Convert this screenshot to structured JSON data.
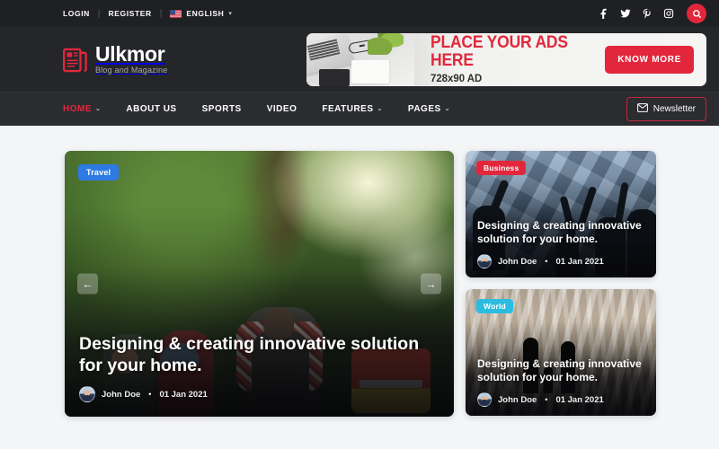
{
  "topbar": {
    "login": "LOGIN",
    "register": "REGISTER",
    "separator": "|",
    "language": "ENGLISH",
    "language_caret": "▾",
    "socials": [
      {
        "name": "facebook-icon",
        "label": "Facebook"
      },
      {
        "name": "twitter-icon",
        "label": "Twitter"
      },
      {
        "name": "pinterest-icon",
        "label": "Pinterest"
      },
      {
        "name": "instagram-icon",
        "label": "Instagram"
      }
    ],
    "search_label": "Search"
  },
  "brand": {
    "name": "Ulkmor",
    "tagline": "Blog and Magazine",
    "accent": "#e2273c"
  },
  "ad": {
    "title": "PLACE YOUR ADS HERE",
    "subtitle": "728x90 AD",
    "cta": "KNOW MORE"
  },
  "nav": {
    "items": [
      {
        "label": "HOME",
        "active": true,
        "caret": "⌄"
      },
      {
        "label": "ABOUT US",
        "active": false,
        "caret": ""
      },
      {
        "label": "SPORTS",
        "active": false,
        "caret": ""
      },
      {
        "label": "VIDEO",
        "active": false,
        "caret": ""
      },
      {
        "label": "FEATURES",
        "active": false,
        "caret": "⌄"
      },
      {
        "label": "PAGES",
        "active": false,
        "caret": "⌄"
      }
    ],
    "newsletter": "Newsletter"
  },
  "hero": {
    "badge": "Travel",
    "badge_color": "#2d7ae5",
    "title": "Designing & creating innovative solution for your home.",
    "author": "John Doe",
    "separator": "•",
    "date": "01 Jan 2021",
    "prev": "←",
    "next": "→"
  },
  "side_cards": [
    {
      "badge": "Business",
      "badge_color": "#e2273c",
      "title": "Designing & creating innovative solution for your home.",
      "author": "John Doe",
      "separator": "•",
      "date": "01 Jan 2021"
    },
    {
      "badge": "World",
      "badge_color": "#2bbde0",
      "title": "Designing & creating innovative solution for your home.",
      "author": "John Doe",
      "separator": "•",
      "date": "01 Jan 2021"
    }
  ]
}
